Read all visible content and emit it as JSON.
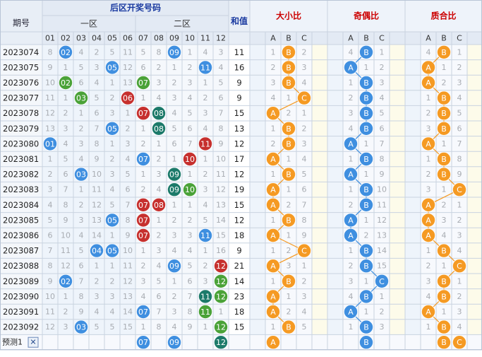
{
  "header": {
    "period_label": "期号",
    "back_zone_title": "后区开奖号码",
    "zone1_label": "一区",
    "zone2_label": "二区",
    "sum_label": "和值",
    "size_ratio_label": "大小比",
    "odd_even_label": "奇偶比",
    "prime_comp_label": "质合比",
    "numbers": [
      "01",
      "02",
      "03",
      "04",
      "05",
      "06",
      "07",
      "08",
      "09",
      "10",
      "11",
      "12"
    ],
    "abc": [
      "A",
      "B",
      "C"
    ]
  },
  "colors": {
    "blue": "#3f8fe0",
    "green": "#4aa238",
    "red": "#c6302e",
    "teal": "#1c7a6a",
    "orange": "#f59a23",
    "gray": "#959595",
    "title": "#cc0000",
    "blue_title": "#1a3aa0"
  },
  "rows": [
    {
      "period": "2023074",
      "cells": [
        8,
        "b02",
        4,
        2,
        5,
        11,
        5,
        8,
        "b09",
        1,
        4,
        3
      ],
      "sum": "11",
      "s": [
        1,
        "B",
        2
      ],
      "o": [
        4,
        "B",
        1
      ],
      "p": [
        4,
        "B",
        1
      ]
    },
    {
      "period": "2023075",
      "cells": [
        9,
        1,
        5,
        3,
        "b05",
        12,
        6,
        2,
        1,
        2,
        "b11",
        4
      ],
      "sum": "16",
      "s": [
        2,
        "B",
        3
      ],
      "o": [
        "A",
        1,
        2
      ],
      "p": [
        "A",
        1,
        2
      ]
    },
    {
      "period": "2023076",
      "cells": [
        10,
        "g02",
        6,
        4,
        1,
        13,
        "g07",
        3,
        2,
        3,
        1,
        5
      ],
      "sum": "9",
      "s": [
        3,
        "B",
        4
      ],
      "o": [
        1,
        "B",
        3
      ],
      "p": [
        "A",
        2,
        3
      ]
    },
    {
      "period": "2023077",
      "cells": [
        11,
        1,
        "g03",
        5,
        2,
        "r06",
        1,
        4,
        3,
        4,
        2,
        6
      ],
      "sum": "9",
      "s": [
        4,
        1,
        "C"
      ],
      "o": [
        2,
        "B",
        4
      ],
      "p": [
        1,
        "B",
        4
      ]
    },
    {
      "period": "2023078",
      "cells": [
        12,
        2,
        1,
        6,
        3,
        1,
        "r07",
        "t08",
        4,
        5,
        3,
        7
      ],
      "sum": "15",
      "s": [
        "A",
        2,
        1
      ],
      "o": [
        3,
        "B",
        5
      ],
      "p": [
        2,
        "B",
        5
      ]
    },
    {
      "period": "2023079",
      "cells": [
        13,
        3,
        2,
        7,
        "b05",
        2,
        1,
        "t08",
        5,
        6,
        4,
        8
      ],
      "sum": "13",
      "s": [
        1,
        "B",
        2
      ],
      "o": [
        4,
        "B",
        6
      ],
      "p": [
        3,
        "B",
        6
      ]
    },
    {
      "period": "2023080",
      "cells": [
        "b01",
        4,
        3,
        8,
        1,
        3,
        2,
        1,
        6,
        7,
        "r11",
        9
      ],
      "sum": "12",
      "s": [
        2,
        "B",
        3
      ],
      "o": [
        "A",
        1,
        7
      ],
      "p": [
        "A",
        1,
        7
      ]
    },
    {
      "period": "2023081",
      "cells": [
        1,
        5,
        4,
        9,
        2,
        4,
        "b07",
        2,
        1,
        "r10",
        1,
        10
      ],
      "sum": "17",
      "s": [
        "A",
        1,
        4
      ],
      "o": [
        1,
        "B",
        8
      ],
      "p": [
        1,
        "B",
        8
      ]
    },
    {
      "period": "2023082",
      "cells": [
        2,
        6,
        "b03",
        10,
        3,
        5,
        1,
        3,
        "t09",
        1,
        2,
        11
      ],
      "sum": "12",
      "s": [
        1,
        "B",
        5
      ],
      "o": [
        "A",
        1,
        9
      ],
      "p": [
        2,
        "B",
        9
      ]
    },
    {
      "period": "2023083",
      "cells": [
        3,
        7,
        1,
        11,
        4,
        6,
        2,
        4,
        "t09",
        "g10",
        3,
        12
      ],
      "sum": "19",
      "s": [
        "A",
        1,
        6
      ],
      "o": [
        1,
        "B",
        10
      ],
      "p": [
        3,
        1,
        "C"
      ]
    },
    {
      "period": "2023084",
      "cells": [
        4,
        8,
        2,
        12,
        5,
        7,
        "r07",
        "r08",
        1,
        1,
        4,
        13
      ],
      "sum": "15",
      "s": [
        "A",
        2,
        7
      ],
      "o": [
        2,
        "B",
        11
      ],
      "p": [
        "A",
        2,
        1
      ]
    },
    {
      "period": "2023085",
      "cells": [
        5,
        9,
        3,
        13,
        "b05",
        8,
        "r07",
        1,
        2,
        2,
        5,
        14
      ],
      "sum": "12",
      "s": [
        1,
        "B",
        8
      ],
      "o": [
        "A",
        1,
        12
      ],
      "p": [
        "A",
        3,
        2
      ]
    },
    {
      "period": "2023086",
      "cells": [
        6,
        10,
        4,
        14,
        1,
        9,
        "r07",
        2,
        3,
        3,
        "b11",
        15
      ],
      "sum": "18",
      "s": [
        "A",
        1,
        9
      ],
      "o": [
        "A",
        2,
        13
      ],
      "p": [
        "A",
        4,
        3
      ]
    },
    {
      "period": "2023087",
      "cells": [
        7,
        11,
        5,
        "b04",
        "b05",
        10,
        1,
        3,
        4,
        4,
        1,
        16
      ],
      "sum": "9",
      "s": [
        1,
        2,
        "C"
      ],
      "o": [
        1,
        "B",
        14
      ],
      "p": [
        1,
        "B",
        4
      ]
    },
    {
      "period": "2023088",
      "cells": [
        8,
        12,
        6,
        1,
        1,
        11,
        2,
        4,
        "b09",
        5,
        2,
        "r12"
      ],
      "sum": "21",
      "s": [
        "A",
        3,
        1
      ],
      "o": [
        2,
        "B",
        15
      ],
      "p": [
        2,
        1,
        "C"
      ]
    },
    {
      "period": "2023089",
      "cells": [
        9,
        "b02",
        7,
        2,
        2,
        12,
        3,
        5,
        1,
        6,
        3,
        "g12"
      ],
      "sum": "14",
      "s": [
        1,
        "B",
        2
      ],
      "o": [
        3,
        1,
        "C"
      ],
      "p": [
        3,
        "B",
        1
      ]
    },
    {
      "period": "2023090",
      "cells": [
        10,
        1,
        8,
        3,
        3,
        13,
        4,
        6,
        2,
        7,
        "t11",
        "g12"
      ],
      "sum": "23",
      "s": [
        "A",
        1,
        3
      ],
      "o": [
        4,
        "B",
        1
      ],
      "p": [
        4,
        "B",
        2
      ]
    },
    {
      "period": "2023091",
      "cells": [
        11,
        2,
        9,
        4,
        4,
        14,
        "b07",
        7,
        3,
        8,
        "g11",
        1
      ],
      "sum": "18",
      "s": [
        "A",
        2,
        4
      ],
      "o": [
        "A",
        1,
        2
      ],
      "p": [
        "A",
        1,
        3
      ]
    },
    {
      "period": "2023092",
      "cells": [
        12,
        3,
        "b03",
        5,
        5,
        15,
        1,
        8,
        4,
        9,
        1,
        "g12"
      ],
      "sum": "15",
      "s": [
        1,
        "B",
        5
      ],
      "o": [
        1,
        "B",
        3
      ],
      "p": [
        1,
        "B",
        4
      ]
    }
  ],
  "forecast": {
    "label": "预测1",
    "close_symbol": "✕",
    "balls": [
      {
        "col": 7,
        "num": "07"
      },
      {
        "col": 9,
        "num": "09"
      },
      {
        "col": 12,
        "num": "12"
      }
    ],
    "s": [
      "A"
    ],
    "o": [
      "B"
    ],
    "p": [
      "B",
      "C"
    ]
  }
}
